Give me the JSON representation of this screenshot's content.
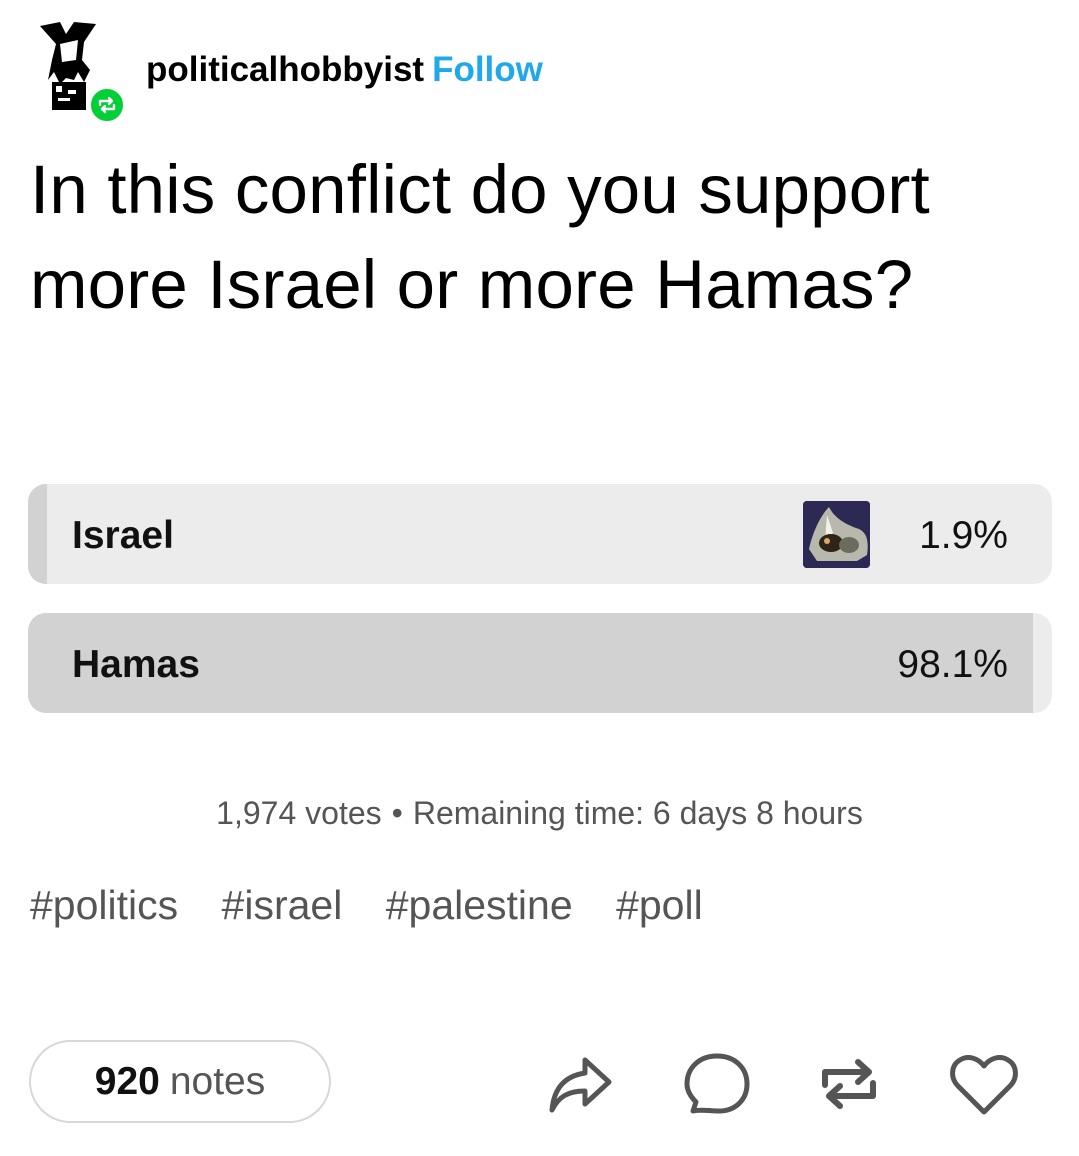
{
  "post": {
    "username": "politicalhobbyist",
    "follow_label": "Follow",
    "question": "In this conflict do you support more Israel or more Hamas?"
  },
  "poll": {
    "options": [
      {
        "label": "Israel",
        "percent": "1.9%",
        "share": 0.019
      },
      {
        "label": "Hamas",
        "percent": "98.1%",
        "share": 0.981
      }
    ],
    "votes": "1,974 votes",
    "separator": "•",
    "remaining": "Remaining time: 6 days 8 hours"
  },
  "tags": [
    "#politics",
    "#israel",
    "#palestine",
    "#poll"
  ],
  "footer": {
    "notes_count": "920",
    "notes_label": "notes"
  },
  "colors": {
    "accent": "#1fa8ea",
    "reblog_green": "#00cf35",
    "bar_fill": "#d2d2d2",
    "bar_track": "#ececec"
  },
  "icons": [
    "reblog-icon",
    "share-icon",
    "reply-icon",
    "reblog-icon",
    "heart-icon"
  ]
}
